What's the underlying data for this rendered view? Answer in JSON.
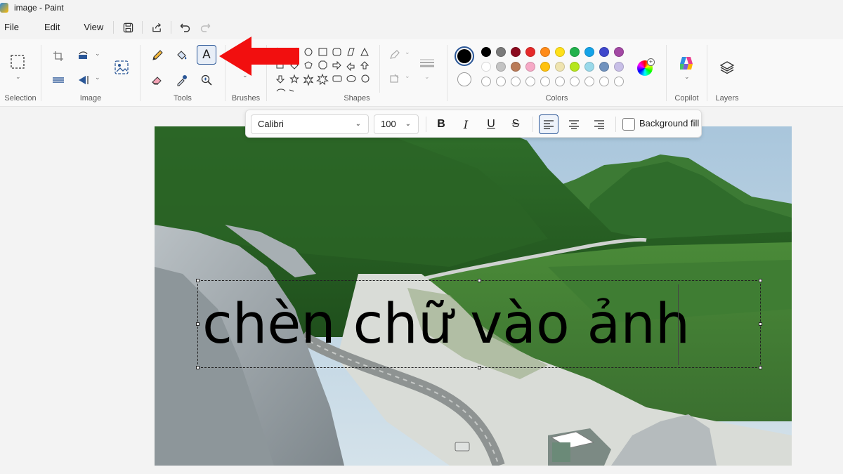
{
  "window": {
    "title": "image - Paint"
  },
  "menu": {
    "file": "File",
    "edit": "Edit",
    "view": "View"
  },
  "ribbon": {
    "groups": {
      "selection": "Selection",
      "image": "Image",
      "tools": "Tools",
      "brushes": "Brushes",
      "shapes": "Shapes",
      "colors": "Colors",
      "copilot": "Copilot",
      "layers": "Layers"
    },
    "text_tool_glyph": "A",
    "colors": {
      "primary": "#000000",
      "row1": [
        "#000000",
        "#7a7a7a",
        "#8b0a1e",
        "#e52a2a",
        "#ff8c1a",
        "#ffe01a",
        "#22b14c",
        "#14a3e8",
        "#3f48cc",
        "#a349a4"
      ],
      "row2": [
        "#ffffff",
        "#c3c3c3",
        "#b97a57",
        "#f6a9c6",
        "#ffc20e",
        "#efe4b0",
        "#b5e61d",
        "#99d9ea",
        "#7092be",
        "#c8bfe7"
      ]
    }
  },
  "text_toolbar": {
    "font": "Calibri",
    "size": "100",
    "bold": "B",
    "italic": "I",
    "underline": "U",
    "strike": "S",
    "background_fill": "Background fill"
  },
  "canvas": {
    "text": "chèn chữ vào ảnh"
  }
}
